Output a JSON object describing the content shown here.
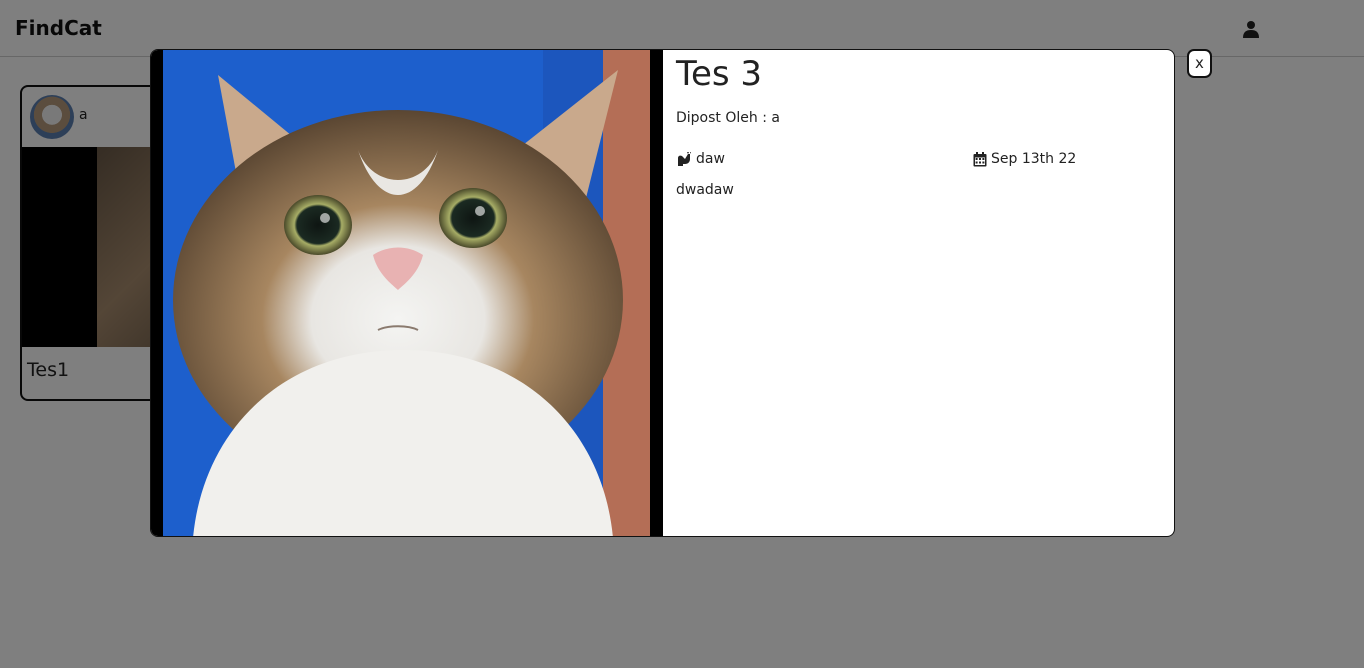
{
  "navbar": {
    "brand": "FindCat",
    "user_icon": "user-icon"
  },
  "card": {
    "user": "a",
    "title": "Tes1"
  },
  "modal": {
    "title": "Tes 3",
    "posted_by": "Dipost Oleh : a",
    "breed_icon": "cat-icon",
    "breed": "daw",
    "date_icon": "calendar-icon",
    "date": "Sep 13th 22",
    "description": "dwadaw",
    "close_label": "x"
  },
  "colors": {
    "overlay": "#808080",
    "modal_bg": "#ffffff",
    "text": "#222222"
  }
}
